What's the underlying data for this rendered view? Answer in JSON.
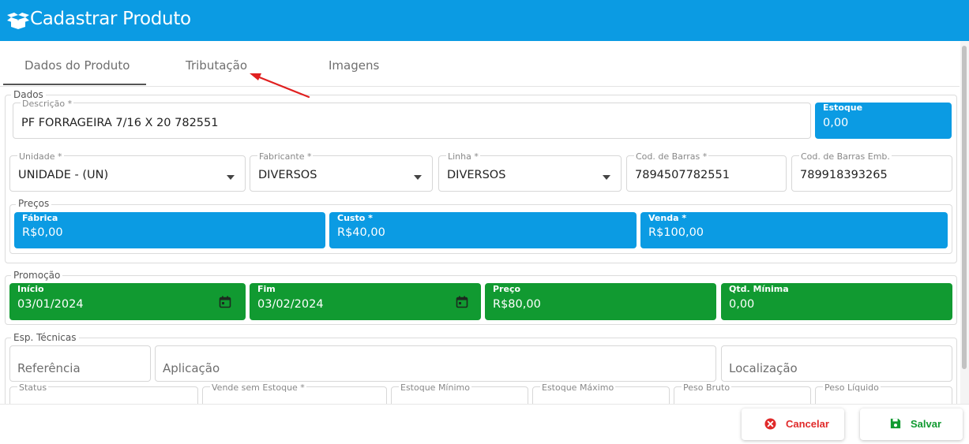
{
  "app": {
    "title": "Cadastrar Produto",
    "header_color": "#0b9be3",
    "icon": "box-open-icon"
  },
  "tabs": [
    {
      "label": "Dados do Produto",
      "active": true
    },
    {
      "label": "Tributação",
      "active": false
    },
    {
      "label": "Imagens",
      "active": false
    }
  ],
  "dados": {
    "section_title": "Dados",
    "descricao": {
      "label": "Descrição *",
      "value": "PF FORRAGEIRA 7/16 X 20 782551"
    },
    "estoque": {
      "label": "Estoque",
      "value": "0,00"
    },
    "unidade": {
      "label": "Unidade *",
      "value": "UNIDADE - (UN)"
    },
    "fabricante": {
      "label": "Fabricante *",
      "value": "DIVERSOS"
    },
    "linha": {
      "label": "Linha *",
      "value": "DIVERSOS"
    },
    "cod_barras": {
      "label": "Cod. de Barras *",
      "value": "7894507782551"
    },
    "cod_barras_emb": {
      "label": "Cod. de Barras Emb.",
      "value": "789918393265"
    }
  },
  "precos": {
    "section_title": "Preços",
    "fabrica": {
      "label": "Fábrica",
      "value": "R$0,00"
    },
    "custo": {
      "label": "Custo *",
      "value": "R$40,00"
    },
    "venda": {
      "label": "Venda *",
      "value": "R$100,00"
    }
  },
  "promocao": {
    "section_title": "Promoção",
    "inicio": {
      "label": "Início",
      "value": "03/01/2024"
    },
    "fim": {
      "label": "Fim",
      "value": "03/02/2024"
    },
    "preco": {
      "label": "Preço",
      "value": "R$80,00"
    },
    "qtd_minima": {
      "label": "Qtd. Mínima",
      "value": "0,00"
    }
  },
  "esp_tecnicas": {
    "section_title": "Esp. Técnicas",
    "referencia": {
      "placeholder": "Referência"
    },
    "aplicacao": {
      "placeholder": "Aplicação"
    },
    "localizacao": {
      "placeholder": "Localização"
    },
    "status": {
      "label": "Status"
    },
    "vende_sem_estoque": {
      "label": "Vende sem Estoque *"
    },
    "estoque_minimo": {
      "label": "Estoque Mínimo"
    },
    "estoque_maximo": {
      "label": "Estoque Máximo"
    },
    "peso_bruto": {
      "label": "Peso Bruto"
    },
    "peso_liquido": {
      "label": "Peso Líquido"
    }
  },
  "footer": {
    "cancel_label": "Cancelar",
    "save_label": "Salvar",
    "cancel_color": "#e02a2a",
    "save_color": "#119a31"
  },
  "colors": {
    "primary": "#0b9be3",
    "promo": "#119a31",
    "annotation_arrow": "#e02020"
  }
}
